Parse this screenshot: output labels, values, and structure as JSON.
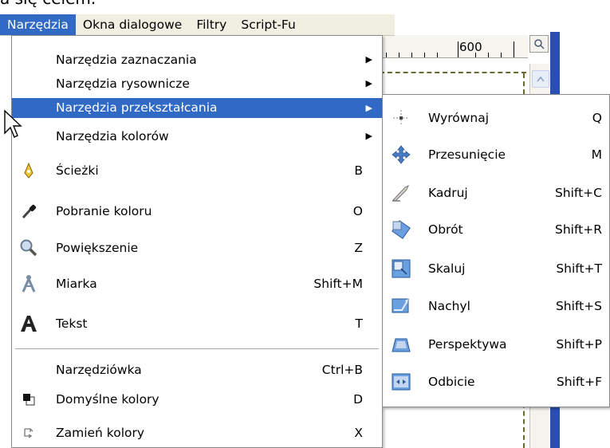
{
  "caption": "a się celem.",
  "menubar": {
    "items": [
      {
        "label": "Narzędzia",
        "active": true
      },
      {
        "label": "Okna dialogowe",
        "active": false
      },
      {
        "label": "Filtry",
        "active": false
      },
      {
        "label": "Script-Fu",
        "active": false
      }
    ]
  },
  "ruler": {
    "label": "600"
  },
  "main_menu": {
    "items": [
      {
        "label": "Narzędzia zaznaczania",
        "shortcut": "",
        "submenu": true,
        "icon": "none"
      },
      {
        "label": "Narzędzia rysownicze",
        "shortcut": "",
        "submenu": true,
        "icon": "none"
      },
      {
        "label": "Narzędzia przekształcania",
        "shortcut": "",
        "submenu": true,
        "icon": "none",
        "highlighted": true
      },
      {
        "label": "Narzędzia kolorów",
        "shortcut": "",
        "submenu": true,
        "icon": "none"
      },
      {
        "label": "Ścieżki",
        "shortcut": "B",
        "icon": "path-pen-icon"
      },
      {
        "label": "Pobranie koloru",
        "shortcut": "O",
        "icon": "color-picker-icon"
      },
      {
        "label": "Powiększenie",
        "shortcut": "Z",
        "icon": "magnifier-icon"
      },
      {
        "label": "Miarka",
        "shortcut": "Shift+M",
        "icon": "measure-compass-icon"
      },
      {
        "label": "Tekst",
        "shortcut": "T",
        "icon": "text-icon"
      },
      {
        "label": "Narzędziówka",
        "shortcut": "Ctrl+B",
        "icon": "none"
      },
      {
        "label": "Domyślne kolory",
        "shortcut": "D",
        "icon": "default-colors-icon"
      },
      {
        "label": "Zamień kolory",
        "shortcut": "X",
        "icon": "swap-colors-icon"
      }
    ]
  },
  "sub_menu": {
    "items": [
      {
        "label": "Wyrównaj",
        "shortcut": "Q",
        "icon": "align-icon"
      },
      {
        "label": "Przesunięcie",
        "shortcut": "M",
        "icon": "move-icon"
      },
      {
        "label": "Kadruj",
        "shortcut": "Shift+C",
        "icon": "crop-knife-icon"
      },
      {
        "label": "Obrót",
        "shortcut": "Shift+R",
        "icon": "rotate-icon"
      },
      {
        "label": "Skaluj",
        "shortcut": "Shift+T",
        "icon": "scale-icon"
      },
      {
        "label": "Nachyl",
        "shortcut": "Shift+S",
        "icon": "shear-icon"
      },
      {
        "label": "Perspektywa",
        "shortcut": "Shift+P",
        "icon": "perspective-icon"
      },
      {
        "label": "Odbicie",
        "shortcut": "Shift+F",
        "icon": "flip-icon"
      }
    ]
  },
  "colors": {
    "highlight": "#316ac5",
    "menubar": "#f1efe2",
    "frame_blue": "#2a4fb4"
  }
}
